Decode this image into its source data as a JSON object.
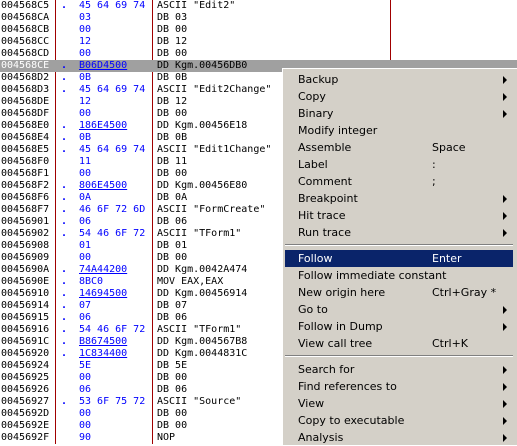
{
  "dump": {
    "rows": [
      {
        "addr": "004568C5",
        "mark": ".",
        "hex": "45 64 69 74",
        "cmt": "ASCII \"Edit2\""
      },
      {
        "addr": "004568CA",
        "mark": "",
        "hex": "03",
        "cmt": "DB 03"
      },
      {
        "addr": "004568CB",
        "mark": "",
        "hex": "00",
        "cmt": "DB 00"
      },
      {
        "addr": "004568CC",
        "mark": "",
        "hex": "12",
        "cmt": "DB 12"
      },
      {
        "addr": "004568CD",
        "mark": "",
        "hex": "00",
        "cmt": "DB 00"
      },
      {
        "addr": "004568CE",
        "mark": ".",
        "hex": "B06D4500",
        "cmt": "DD Kgm.00456DB0"
      },
      {
        "addr": "004568D2",
        "mark": ".",
        "hex": "0B",
        "cmt": "DB 0B"
      },
      {
        "addr": "004568D3",
        "mark": ".",
        "hex": "45 64 69 74",
        "cmt": "ASCII \"Edit2Change\""
      },
      {
        "addr": "004568DE",
        "mark": "",
        "hex": "12",
        "cmt": "DB 12"
      },
      {
        "addr": "004568DF",
        "mark": "",
        "hex": "00",
        "cmt": "DB 00"
      },
      {
        "addr": "004568E0",
        "mark": ".",
        "hex": "186E4500",
        "cmt": "DD Kgm.00456E18"
      },
      {
        "addr": "004568E4",
        "mark": ".",
        "hex": "0B",
        "cmt": "DB 0B"
      },
      {
        "addr": "004568E5",
        "mark": ".",
        "hex": "45 64 69 74",
        "cmt": "ASCII \"Edit1Change\""
      },
      {
        "addr": "004568F0",
        "mark": "",
        "hex": "11",
        "cmt": "DB 11"
      },
      {
        "addr": "004568F1",
        "mark": "",
        "hex": "00",
        "cmt": "DB 00"
      },
      {
        "addr": "004568F2",
        "mark": ".",
        "hex": "806E4500",
        "cmt": "DD Kgm.00456E80"
      },
      {
        "addr": "004568F6",
        "mark": ".",
        "hex": "0A",
        "cmt": "DB 0A"
      },
      {
        "addr": "004568F7",
        "mark": ".",
        "hex": "46 6F 72 6D",
        "cmt": "ASCII \"FormCreate\""
      },
      {
        "addr": "00456901",
        "mark": ".",
        "hex": "06",
        "cmt": "DB 06"
      },
      {
        "addr": "00456902",
        "mark": ".",
        "hex": "54 46 6F 72",
        "cmt": "ASCII \"TForm1\""
      },
      {
        "addr": "00456908",
        "mark": "",
        "hex": "01",
        "cmt": "DB 01"
      },
      {
        "addr": "00456909",
        "mark": "",
        "hex": "00",
        "cmt": "DB 00"
      },
      {
        "addr": "0045690A",
        "mark": ".",
        "hex": "74A44200",
        "cmt": "DD Kgm.0042A474"
      },
      {
        "addr": "0045690E",
        "mark": ".",
        "hex": "8BC0",
        "cmt": "MOV EAX,EAX"
      },
      {
        "addr": "00456910",
        "mark": ".",
        "hex": "14694500",
        "cmt": "DD Kgm.00456914"
      },
      {
        "addr": "00456914",
        "mark": ".",
        "hex": "07",
        "cmt": "DB 07"
      },
      {
        "addr": "00456915",
        "mark": ".",
        "hex": "06",
        "cmt": "DB 06"
      },
      {
        "addr": "00456916",
        "mark": ".",
        "hex": "54 46 6F 72",
        "cmt": "ASCII \"TForm1\""
      },
      {
        "addr": "0045691C",
        "mark": ".",
        "hex": "B8674500",
        "cmt": "DD Kgm.004567B8"
      },
      {
        "addr": "00456920",
        "mark": ".",
        "hex": "1C834400",
        "cmt": "DD Kgm.0044831C"
      },
      {
        "addr": "00456924",
        "mark": "",
        "hex": "5E",
        "cmt": "DB 5E"
      },
      {
        "addr": "00456925",
        "mark": "",
        "hex": "00",
        "cmt": "DB 00"
      },
      {
        "addr": "00456926",
        "mark": "",
        "hex": "06",
        "cmt": "DB 06"
      },
      {
        "addr": "00456927",
        "mark": ".",
        "hex": "53 6F 75 72",
        "cmt": "ASCII \"Source\""
      },
      {
        "addr": "0045692D",
        "mark": "",
        "hex": "00",
        "cmt": "DB 00"
      },
      {
        "addr": "0045692E",
        "mark": "",
        "hex": "00",
        "cmt": "DB 00"
      },
      {
        "addr": "0045692F",
        "mark": "",
        "hex": "90",
        "cmt": "NOP"
      }
    ]
  },
  "context_menu": {
    "items": [
      {
        "label": "Backup",
        "shortcut": ""
      },
      {
        "label": "Copy",
        "shortcut": ""
      },
      {
        "label": "Binary",
        "shortcut": ""
      },
      {
        "label": "Modify integer",
        "shortcut": ""
      },
      {
        "label": "Assemble",
        "shortcut": "Space"
      },
      {
        "label": "Label",
        "shortcut": ":"
      },
      {
        "label": "Comment",
        "shortcut": ";"
      },
      {
        "label": "Breakpoint",
        "shortcut": ""
      },
      {
        "label": "Hit trace",
        "shortcut": ""
      },
      {
        "label": "Run trace",
        "shortcut": ""
      },
      {
        "label": "Follow",
        "shortcut": "Enter"
      },
      {
        "label": "Follow immediate constant",
        "shortcut": ""
      },
      {
        "label": "New origin here",
        "shortcut": "Ctrl+Gray *"
      },
      {
        "label": "Go to",
        "shortcut": ""
      },
      {
        "label": "Follow in Dump",
        "shortcut": ""
      },
      {
        "label": "View call tree",
        "shortcut": "Ctrl+K"
      },
      {
        "label": "Search for",
        "shortcut": ""
      },
      {
        "label": "Find references to",
        "shortcut": ""
      },
      {
        "label": "View",
        "shortcut": ""
      },
      {
        "label": "Copy to executable",
        "shortcut": ""
      },
      {
        "label": "Analysis",
        "shortcut": ""
      }
    ]
  },
  "colors": {
    "hex_blue": "#0000ff",
    "selected_row": "#a0a0a0",
    "menu_bg": "#d4d0c8",
    "menu_highlight": "#0a246a",
    "column_divider": "#a00000"
  }
}
